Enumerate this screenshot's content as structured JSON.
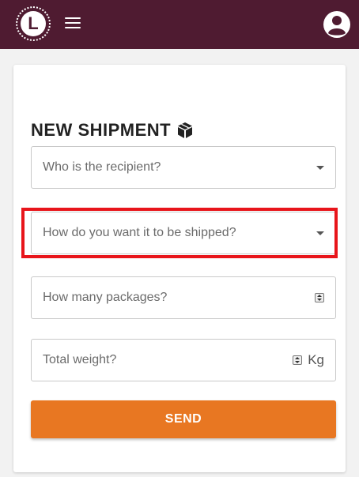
{
  "header": {
    "logo_letter": "L",
    "menu_icon": "hamburger-menu-icon",
    "account_icon": "user-account-icon",
    "background_color": "#4f1b31"
  },
  "form": {
    "title": "NEW SHIPMENT",
    "title_icon": "package-box-icon",
    "recipient_placeholder": "Who is the recipient?",
    "shipping_method_placeholder": "How do you want it to be shipped?",
    "packages_placeholder": "How many packages?",
    "weight_placeholder": "Total weight?",
    "weight_unit": "Kg",
    "send_label": "SEND",
    "send_color": "#e87722",
    "highlight_color": "#e8151b"
  }
}
